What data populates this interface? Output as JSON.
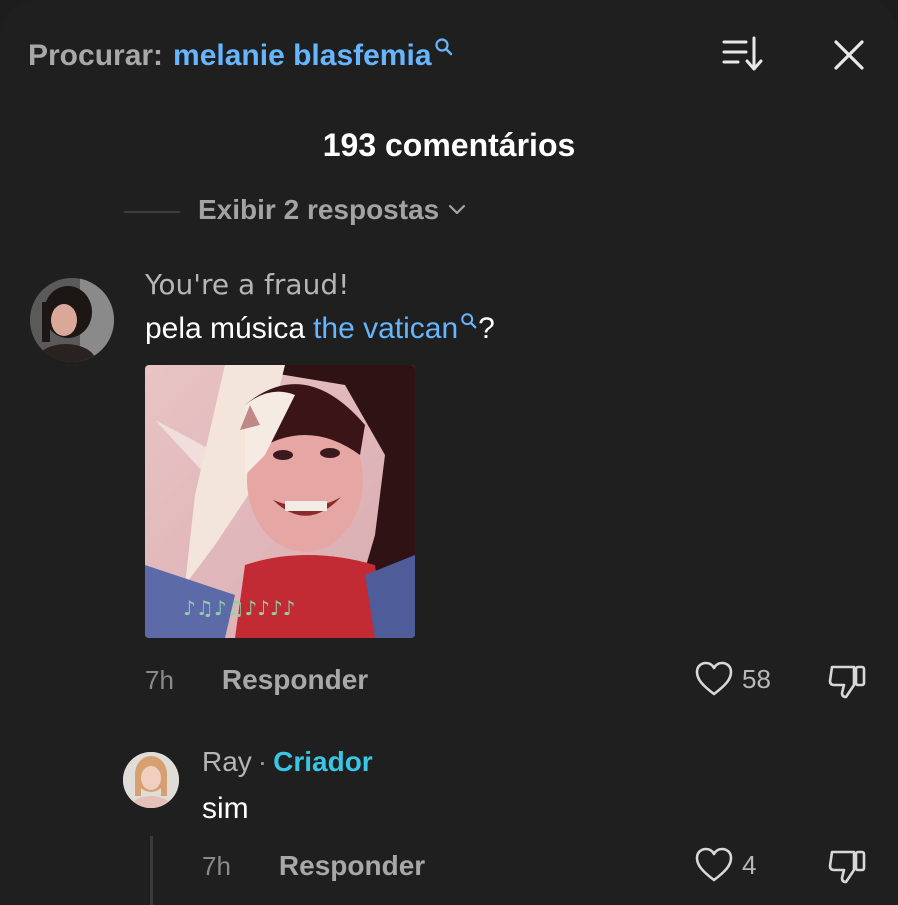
{
  "search": {
    "label": "Procurar:",
    "query": "melanie blasfemia"
  },
  "header": {
    "title": "193 comentários"
  },
  "view_replies": {
    "label": "Exibir 2 respostas"
  },
  "comments": [
    {
      "username": "You're a fraud!",
      "text_before": "pela música",
      "link_text": "the vatican",
      "text_after": "?",
      "time": "7h",
      "reply_label": "Responder",
      "likes": "58"
    },
    {
      "username": "Ray",
      "separator": "·",
      "badge": "Criador",
      "text": "sim",
      "time": "7h",
      "reply_label": "Responder",
      "likes": "4"
    }
  ],
  "colors": {
    "background": "#1f1f1f",
    "link": "#66b6ff",
    "creator_badge": "#39c6e6",
    "muted_text": "#a8a8a8"
  },
  "icons": {
    "sort": "sort-icon",
    "close": "close-icon",
    "search_hint": "search-icon",
    "chevron": "chevron-down-icon",
    "like": "heart-icon",
    "dislike": "thumbs-down-icon"
  }
}
